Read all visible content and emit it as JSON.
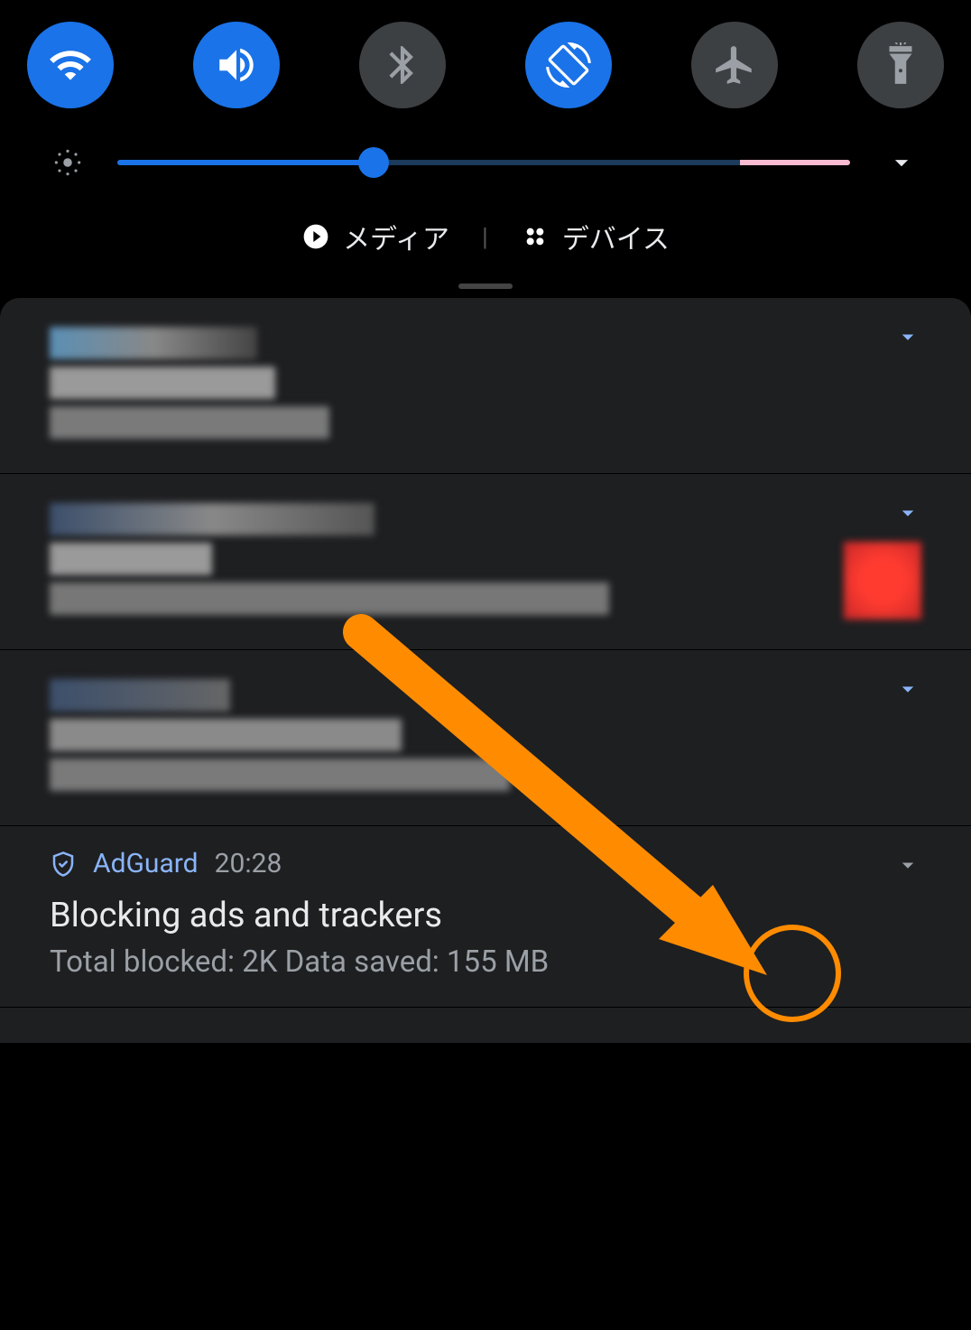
{
  "quick_settings": {
    "tiles": [
      {
        "name": "wifi",
        "active": true
      },
      {
        "name": "sound",
        "active": true
      },
      {
        "name": "bluetooth",
        "active": false
      },
      {
        "name": "auto-rotate",
        "active": true
      },
      {
        "name": "airplane",
        "active": false
      },
      {
        "name": "flashlight",
        "active": false
      }
    ],
    "brightness_percent": 35
  },
  "media_row": {
    "media_label": "メディア",
    "devices_label": "デバイス"
  },
  "notifications": {
    "adguard": {
      "app": "AdGuard",
      "time": "20:28",
      "title": "Blocking ads and trackers",
      "subtitle": "Total blocked: 2K Data saved: 155 MB"
    }
  },
  "annotation": {
    "target": "adguard-expand-chevron",
    "shape": "arrow-and-circle",
    "color": "#ff8c00"
  }
}
